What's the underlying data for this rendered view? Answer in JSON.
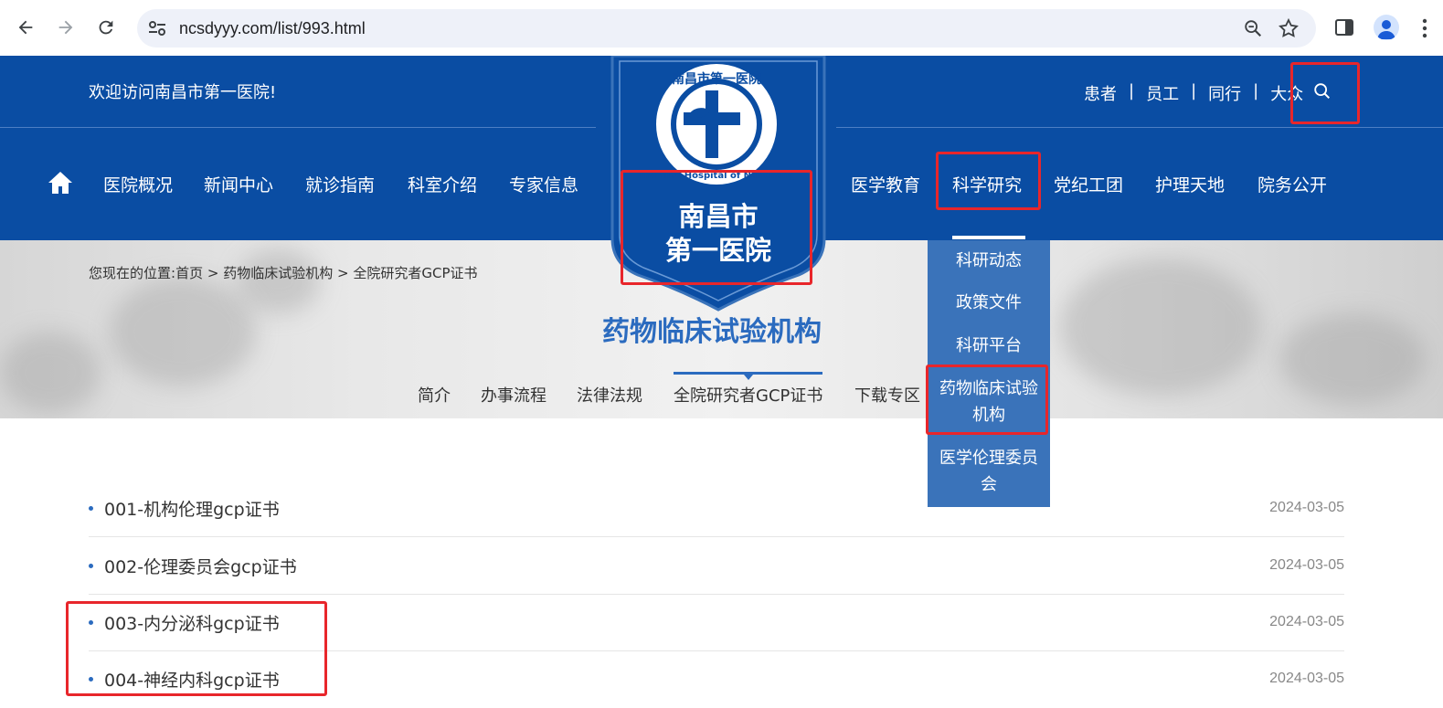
{
  "browser": {
    "url": "ncsdyyy.com/list/993.html",
    "icons": [
      "back-icon",
      "forward-icon",
      "reload-icon",
      "site-info-icon",
      "zoom-icon",
      "bookmark-star-icon",
      "side-panel-icon",
      "profile-icon",
      "menu-icon"
    ]
  },
  "header": {
    "welcome": "欢迎访问南昌市第一医院!",
    "top_links": [
      "患者",
      "员工",
      "同行",
      "大众"
    ],
    "separator": "|",
    "logo": {
      "ring_text": "南昌市第一医院",
      "ring_text_en": "The first Hospital of Nanchang",
      "name_line1": "南昌市",
      "name_line2": "第一医院"
    },
    "nav_left": [
      "医院概况",
      "新闻中心",
      "就诊指南",
      "科室介绍",
      "专家信息"
    ],
    "nav_right": [
      "医学教育",
      "科学研究",
      "党纪工团",
      "护理天地",
      "院务公开"
    ],
    "active_nav": "科学研究"
  },
  "dropdown": {
    "items": [
      "科研动态",
      "政策文件",
      "科研平台",
      "药物临床试验机构",
      "医学伦理委员会"
    ],
    "item_lines": [
      [
        "科研动态"
      ],
      [
        "政策文件"
      ],
      [
        "科研平台"
      ],
      [
        "药物临床试验",
        "机构"
      ],
      [
        "医学伦理委员",
        "会"
      ]
    ]
  },
  "banner": {
    "breadcrumb_label": "您现在的位置:",
    "breadcrumb": [
      "首页",
      "药物临床试验机构",
      "全院研究者GCP证书"
    ],
    "breadcrumb_sep": ">",
    "section_title": "药物临床试验机构",
    "sub_tabs": [
      "简介",
      "办事流程",
      "法律法规",
      "全院研究者GCP证书",
      "下载专区"
    ],
    "active_sub_tab": "全院研究者GCP证书"
  },
  "list": {
    "items": [
      {
        "title": "001-机构伦理gcp证书",
        "date": "2024-03-05"
      },
      {
        "title": "002-伦理委员会gcp证书",
        "date": "2024-03-05"
      },
      {
        "title": "003-内分泌科gcp证书",
        "date": "2024-03-05"
      },
      {
        "title": "004-神经内科gcp证书",
        "date": "2024-03-05"
      }
    ]
  },
  "colors": {
    "header_blue": "#0a4da3",
    "dropdown_blue": "#3a73ba",
    "accent_blue": "#2b6bbf",
    "annotation_red": "#e8262b"
  }
}
